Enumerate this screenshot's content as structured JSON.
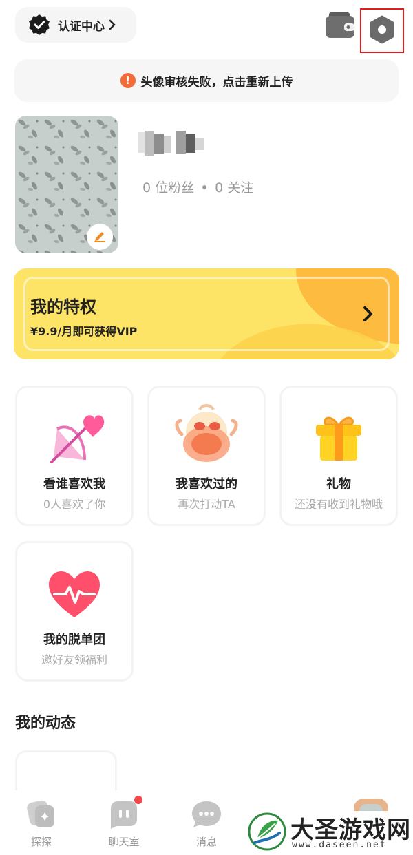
{
  "header": {
    "verify_label": "认证中心",
    "icons": [
      "check-badge-icon",
      "wallet-icon",
      "settings-hex-icon"
    ]
  },
  "banner": {
    "text": "头像审核失败，点击重新上传"
  },
  "profile": {
    "followers": "0 位粉丝",
    "following": "0 关注"
  },
  "vip": {
    "title": "我的特权",
    "subtitle": "¥9.9/月即可获得VIP"
  },
  "features": [
    {
      "title": "看谁喜欢我",
      "subtitle": "0人喜欢了你",
      "icon": "bow-heart-icon"
    },
    {
      "title": "我喜欢过的",
      "subtitle": "再次打动TA",
      "icon": "mascot-icon"
    },
    {
      "title": "礼物",
      "subtitle": "还没有收到礼物哦",
      "icon": "gift-icon"
    },
    {
      "title": "我的脱单团",
      "subtitle": "邀好友领福利",
      "icon": "heartbeat-icon"
    }
  ],
  "section": {
    "title": "我的动态"
  },
  "tabs": [
    {
      "label": "探探",
      "icon": "tantan-icon"
    },
    {
      "label": "聊天室",
      "icon": "chatroom-icon"
    },
    {
      "label": "消息",
      "icon": "message-icon"
    }
  ],
  "watermark": {
    "main": "大圣游戏网",
    "url": "www.daseen.net"
  },
  "colors": {
    "accent": "#fde267",
    "warn": "#f26b3a",
    "highlight_box": "#e01e1e"
  }
}
